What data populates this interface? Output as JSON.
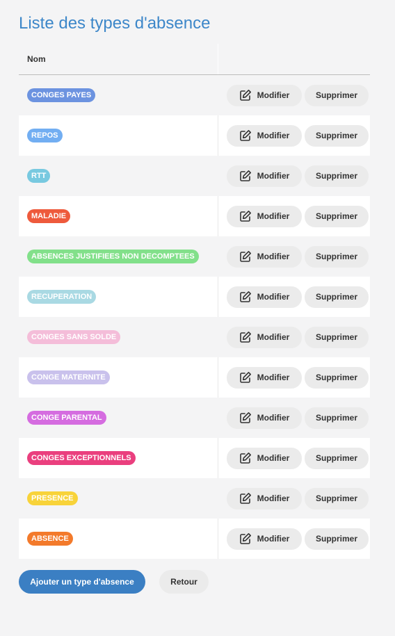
{
  "page": {
    "title": "Liste des types d'absence"
  },
  "table": {
    "header_name": "Nom",
    "rows": [
      {
        "label": "CONGES PAYES",
        "color": "#6c93e0"
      },
      {
        "label": "REPOS",
        "color": "#72aef2"
      },
      {
        "label": "RTT",
        "color": "#78c9e0"
      },
      {
        "label": "MALADIE",
        "color": "#ee5a3c"
      },
      {
        "label": "ABSENCES JUSTIFIEES NON DECOMPTEES",
        "color": "#82e08a"
      },
      {
        "label": "RECUPERATION",
        "color": "#a9d9e3"
      },
      {
        "label": "CONGES SANS SOLDE",
        "color": "#f4bdd9"
      },
      {
        "label": "CONGE MATERNITE",
        "color": "#c9c1ec"
      },
      {
        "label": "CONGE PARENTAL",
        "color": "#d56ce0"
      },
      {
        "label": "CONGES EXCEPTIONNELS",
        "color": "#ea3f7e"
      },
      {
        "label": "PRESENCE",
        "color": "#f8d33a"
      },
      {
        "label": "ABSENCE",
        "color": "#f37a2b"
      }
    ],
    "edit_label": "Modifier",
    "delete_label": "Supprimer"
  },
  "footer": {
    "add_label": "Ajouter un type d'absence",
    "back_label": "Retour"
  }
}
